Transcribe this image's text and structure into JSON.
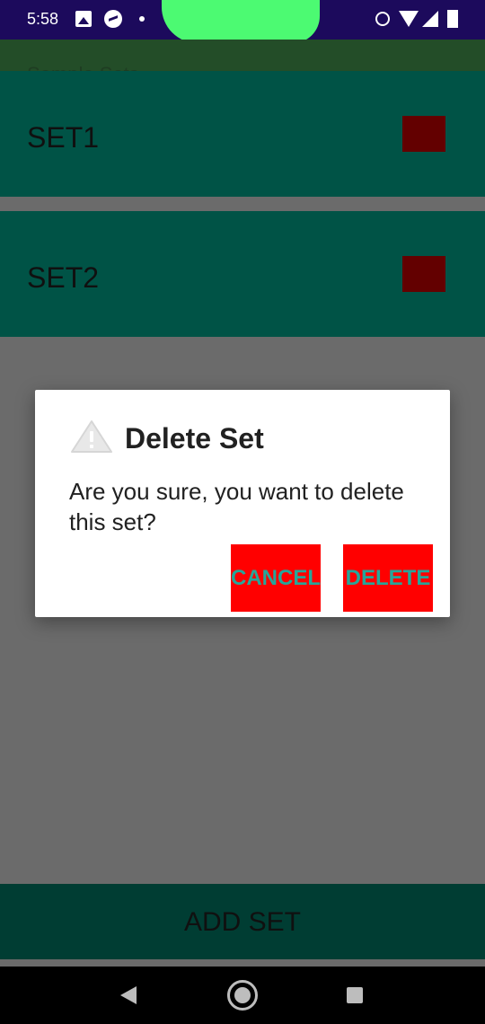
{
  "status_bar": {
    "time": "5:58",
    "icons": [
      "gallery-icon",
      "messenger-icon",
      "dot-icon",
      "alarm-icon",
      "wifi-icon",
      "signal-icon",
      "battery-icon"
    ]
  },
  "app": {
    "title": "Sample Sets"
  },
  "sets": [
    {
      "label": "SET1"
    },
    {
      "label": "SET2"
    }
  ],
  "add_set_label": "ADD SET",
  "dialog": {
    "icon": "warning-icon",
    "title": "Delete Set",
    "message": "Are you sure, you want to delete this set?",
    "cancel_label": "CANCEL",
    "delete_label": "DELETE"
  },
  "colors": {
    "status_bar": "#1c0a5c",
    "row_bg": "#005346",
    "delete_square": "#630000",
    "dialog_button": "#ff0000",
    "dialog_button_text": "#26a69a",
    "scrim": "#6b6b6b"
  }
}
